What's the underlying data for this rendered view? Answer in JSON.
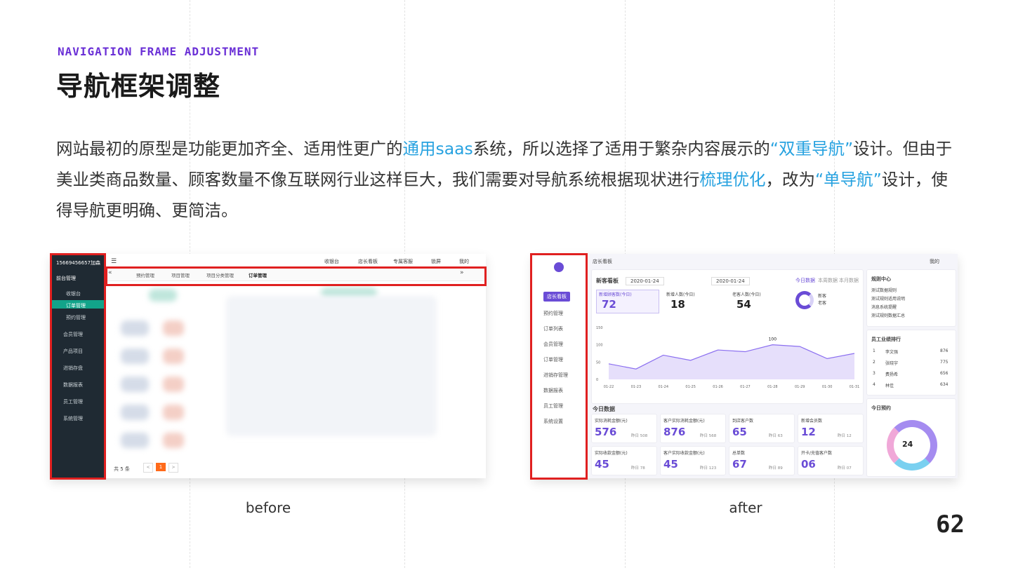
{
  "heading": {
    "subtitle": "NAVIGATION FRAME ADJUSTMENT",
    "title": "导航框架调整"
  },
  "paragraph": {
    "p1": "网站最初的原型是功能更加齐全、适用性更广的",
    "h1": "通用saas",
    "p2": "系统，所以选择了适用于繁杂内容展示的",
    "h2": "“双重导航”",
    "p3": "设计。但由于美业类商品数量、顾客数量不像互联网行业这样巨大，我们需要对导航系统根据现状进行",
    "h3": "梳理优化",
    "p4": "，改为",
    "h4": "“单导航”",
    "p5": "设计，使得导航更明确、更简洁。"
  },
  "captions": {
    "before": "before",
    "after": "after"
  },
  "page_number": "62",
  "before": {
    "account": "15669456657加森",
    "side_items": [
      "前台管理",
      "收银台",
      "订单管理",
      "预约管理",
      "会员管理",
      "产品项目",
      "进销存盘",
      "数据报表",
      "员工管理",
      "系统管理"
    ],
    "top_items": [
      "收银台",
      "店长看板",
      "专属客服",
      "锁屏",
      "我的"
    ],
    "tabs": [
      "预约管理",
      "项目管理",
      "项目分类管理",
      "订单管理"
    ],
    "footer": "共 5 条",
    "page": "1"
  },
  "after": {
    "crumb": "店长看板",
    "user": "我的",
    "store": "店长看板",
    "side_items": [
      "预约管理",
      "订单列表",
      "会员管理",
      "订单管理",
      "进销存管理",
      "数据报表",
      "员工管理",
      "系统设置"
    ],
    "board_title": "新客看板",
    "date_from": "2020-01-24",
    "date_to": "2020-01-24",
    "tabs": [
      "今日数据",
      "本周数据",
      "本月数据"
    ],
    "stats": [
      {
        "label": "新增顾客数(今日)",
        "value": "72"
      },
      {
        "label": "新增人数(今日)",
        "value": "18"
      },
      {
        "label": "老客人数(今日)",
        "value": "54"
      }
    ],
    "legend": [
      "新客",
      "老客"
    ],
    "tooltip": "100",
    "chart_x": [
      "01-22",
      "01-23",
      "01-24",
      "01-25",
      "01-26",
      "01-27",
      "01-28",
      "01-29",
      "01-30",
      "01-31"
    ],
    "chart_y": [
      "150",
      "100",
      "50",
      "0"
    ],
    "chart_values": [
      45,
      30,
      70,
      55,
      85,
      80,
      100,
      95,
      60,
      75
    ],
    "today_title": "今日数据",
    "today": [
      {
        "label": "实际消耗金额(元)",
        "value": "576",
        "sub": "昨日 508"
      },
      {
        "label": "客户实际消耗金额(元)",
        "value": "876",
        "sub": "昨日 568"
      },
      {
        "label": "到店客户数",
        "value": "65",
        "sub": "昨日 63"
      },
      {
        "label": "新增会员数",
        "value": "12",
        "sub": "昨日 12"
      },
      {
        "label": "实际收款金额(元)",
        "value": "45",
        "sub": "昨日 78"
      },
      {
        "label": "客户实际收款金额(元)",
        "value": "45",
        "sub": "昨日 123"
      },
      {
        "label": "总单数",
        "value": "67",
        "sub": "昨日 89"
      },
      {
        "label": "开卡/充值客户数",
        "value": "06",
        "sub": "昨日 07"
      }
    ],
    "right_title1": "规则中心",
    "rules": [
      "测试数据规则",
      "测试规则适用说明",
      "消息系统提醒",
      "测试规则数据汇总"
    ],
    "right_title2": "员工业绩排行",
    "ranks": [
      {
        "n": "1",
        "name": "李文强",
        "v": "876"
      },
      {
        "n": "2",
        "name": "张晓宇",
        "v": "775"
      },
      {
        "n": "3",
        "name": "费扬希",
        "v": "656"
      },
      {
        "n": "4",
        "name": "林佳",
        "v": "634"
      }
    ],
    "right_title3": "今日预约",
    "donut_value": "24"
  }
}
